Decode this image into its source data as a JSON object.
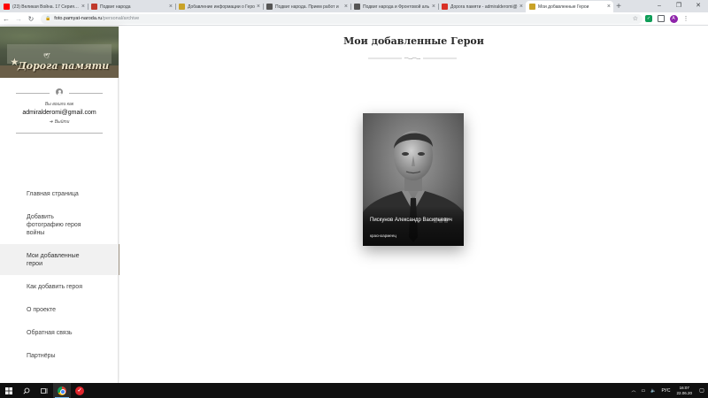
{
  "browser": {
    "tabs": [
      {
        "title": "(23) Великая Война. 17 Серия. Ка",
        "favicon_color": "#ff0000",
        "active": false
      },
      {
        "title": "Подвиг народа",
        "favicon_color": "#c0392b",
        "active": false
      },
      {
        "title": "Добавление информации о Геро",
        "favicon_color": "#c9a227",
        "active": false
      },
      {
        "title": "Подвиг народа. Прием работ и",
        "favicon_color": "#555555",
        "active": false
      },
      {
        "title": "Подвиг народа и Фронтовой аль",
        "favicon_color": "#555555",
        "active": false
      },
      {
        "title": "Дорога памяти - admiralderomi@",
        "favicon_color": "#d93025",
        "active": false
      },
      {
        "title": "Мои добавленные Герои",
        "favicon_color": "#c9a227",
        "active": true
      }
    ],
    "new_tab_icon": "plus-icon",
    "address": {
      "host": "foto.pamyat-naroda.ru",
      "path": "/personal/archive"
    },
    "profile_initial": "A"
  },
  "sidebar": {
    "logo_text": "Дорога памяти",
    "user": {
      "login_label": "Вы вошли как",
      "email": "admiralderomi@gmail.com",
      "logout_label": "Выйти"
    },
    "menu": [
      {
        "label": "Главная страница",
        "active": false
      },
      {
        "label": "Добавить фотографию героя войны",
        "active": false
      },
      {
        "label": "Мои добавленные герои",
        "active": true
      },
      {
        "label": "Как добавить героя",
        "active": false
      },
      {
        "label": "О проекте",
        "active": false
      },
      {
        "label": "Обратная связь",
        "active": false
      },
      {
        "label": "Партнёры",
        "active": false
      }
    ]
  },
  "main": {
    "title": "Мои добавленные Герои",
    "heroes": [
      {
        "name": "Пискунов Александр Васильевич",
        "rank": "красноармеец"
      }
    ]
  },
  "taskbar": {
    "language": "РУС",
    "time": "16:07",
    "date": "22.06.20"
  },
  "colors": {
    "accent": "#9a8f80",
    "active_menu_bg": "#f1f1f1",
    "taskbar": "#101010"
  }
}
